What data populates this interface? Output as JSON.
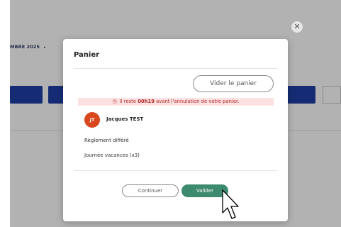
{
  "background": {
    "breadcrumb_text": "MBRE 2025",
    "breadcrumb_arrow": "▸"
  },
  "modal": {
    "title": "Panier",
    "close_glyph": "✕",
    "empty_cart_label": "Vider le panier",
    "alert": {
      "prefix": "Il reste ",
      "time": "00h19",
      "suffix": " avant l'annulation de votre panier."
    },
    "person": {
      "initials": "JT",
      "name": "Jacques TEST"
    },
    "payment_line": "Règlement différé",
    "item_line": "Journée vacances (x3)",
    "continue_label": "Continuer",
    "validate_label": "Valider"
  },
  "colors": {
    "primary_bar": "#1f3fa6",
    "avatar": "#d8471d",
    "validate_button": "#3d8a6e",
    "alert_bg": "#fbe1e1",
    "alert_text": "#b42828"
  }
}
